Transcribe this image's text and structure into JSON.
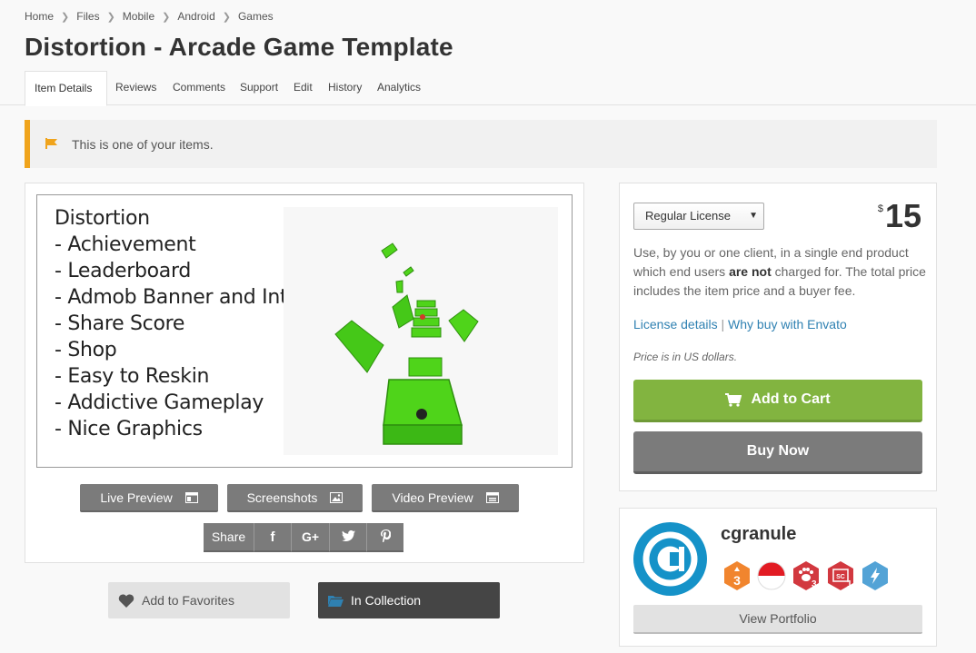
{
  "breadcrumb": [
    "Home",
    "Files",
    "Mobile",
    "Android",
    "Games"
  ],
  "title": "Distortion - Arcade Game Template",
  "tabs": [
    "Item Details",
    "Reviews",
    "Comments",
    "Support",
    "Edit",
    "History",
    "Analytics"
  ],
  "active_tab": "Item Details",
  "notice": {
    "text": "This is one of your items.",
    "icon": "flag-icon",
    "accent": "#f0a41c"
  },
  "preview": {
    "features": [
      "Distortion",
      "- Achievement",
      "- Leaderboard",
      "- Admob Banner and Interstitial",
      "- Share Score",
      "- Shop",
      "- Easy to Reskin",
      "- Addictive Gameplay",
      "- Nice Graphics"
    ],
    "buttons": {
      "live_preview": "Live Preview",
      "screenshots": "Screenshots",
      "video_preview": "Video Preview"
    },
    "share": {
      "label": "Share",
      "networks": [
        "f",
        "G+",
        "twitter",
        "pinterest"
      ]
    }
  },
  "actions": {
    "favorites": "Add to Favorites",
    "collection": "In Collection"
  },
  "purchase": {
    "license": "Regular License",
    "currency": "$",
    "price": "15",
    "desc_part1": "Use, by you or one client, in a single end product which end users ",
    "desc_bold": "are not",
    "desc_part2": " charged for. The total price includes the item price and a buyer fee.",
    "license_details": "License details",
    "separator": "|",
    "why_buy": "Why buy with Envato",
    "price_note": "Price is in US dollars.",
    "add_to_cart": "Add to Cart",
    "buy_now": "Buy Now",
    "colors": {
      "cart": "#82b440",
      "buy": "#7b7b7b"
    }
  },
  "author": {
    "name": "cgranule",
    "badge_labels": [
      "3",
      "3",
      "1"
    ],
    "view_portfolio": "View Portfolio",
    "avatar_color": "#1592c8"
  }
}
